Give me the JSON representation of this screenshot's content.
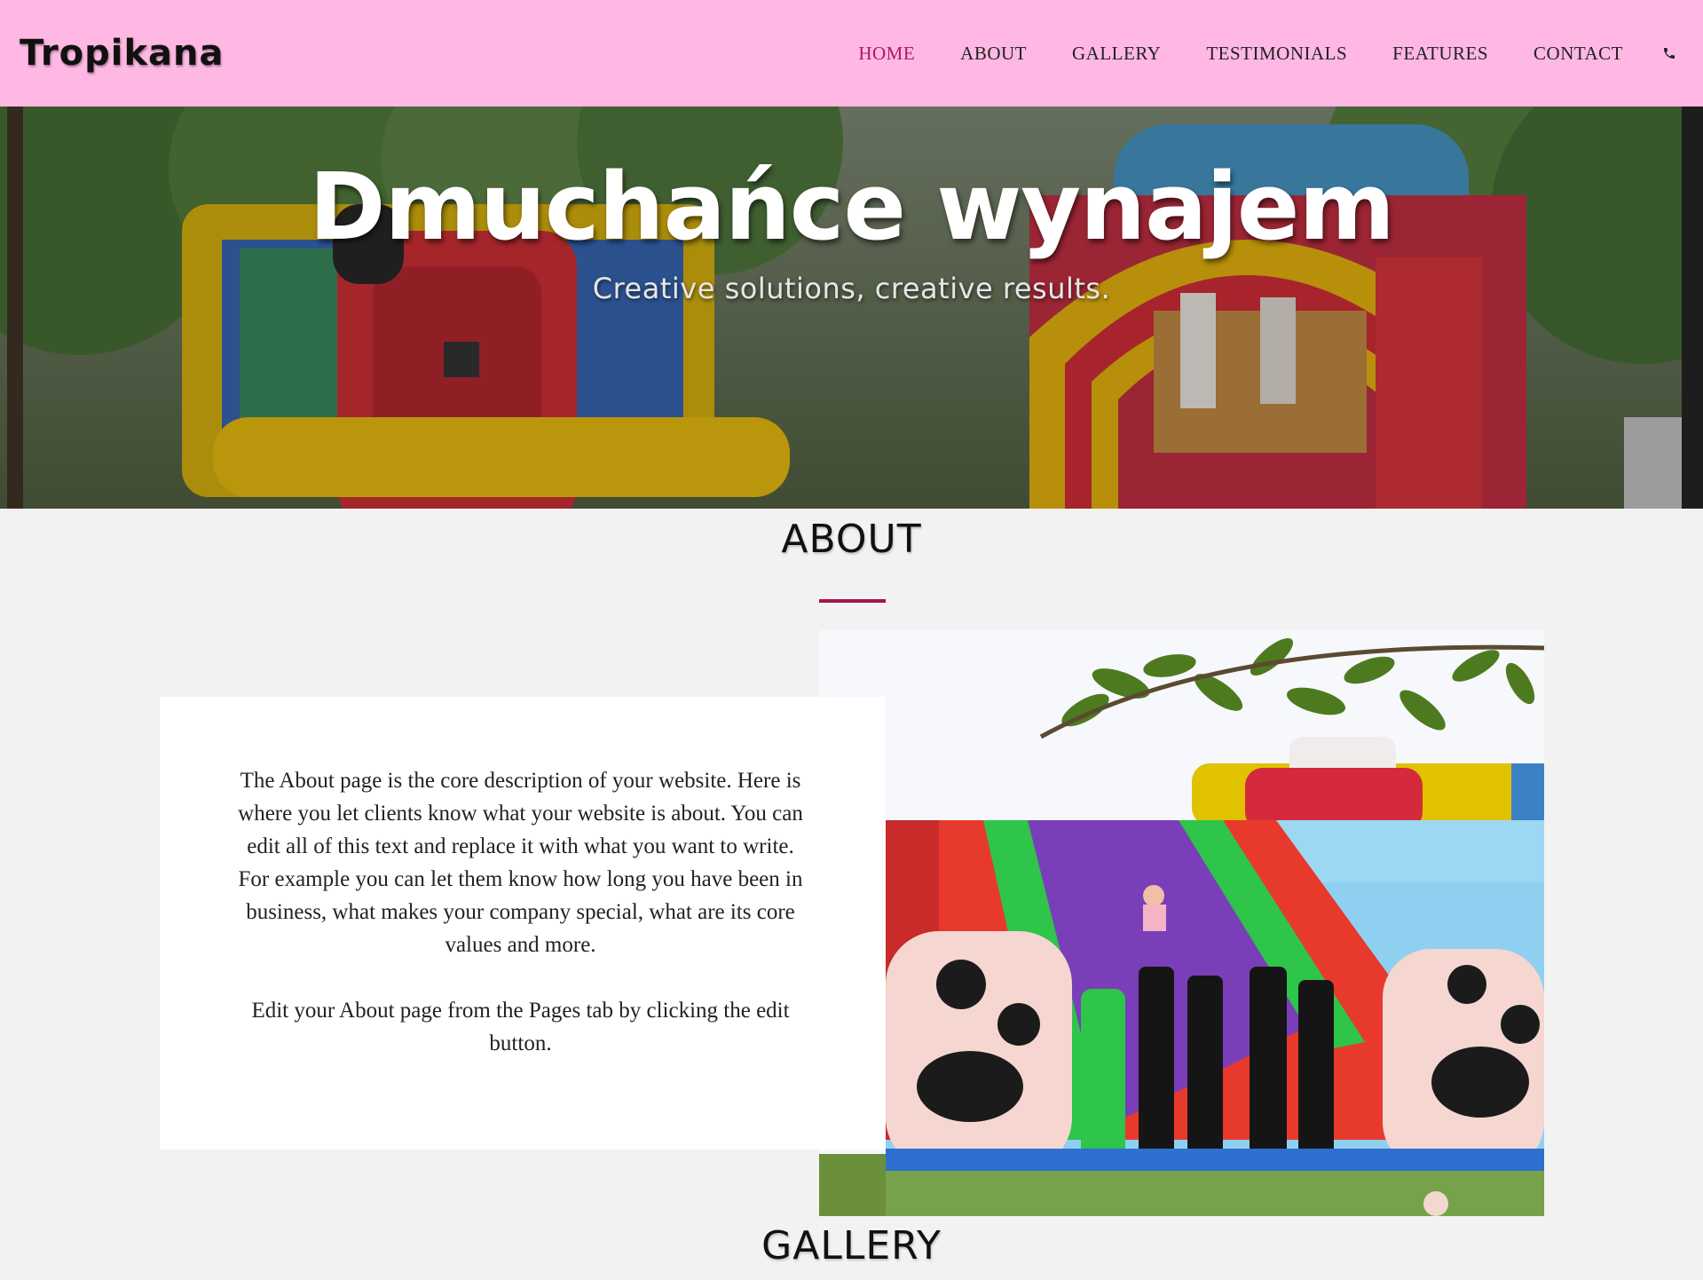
{
  "header": {
    "brand": "Tropikana",
    "nav": [
      {
        "label": "HOME",
        "active": true
      },
      {
        "label": "ABOUT"
      },
      {
        "label": "GALLERY"
      },
      {
        "label": "TESTIMONIALS"
      },
      {
        "label": "FEATURES"
      },
      {
        "label": "CONTACT"
      }
    ],
    "phone_icon": "phone-icon"
  },
  "hero": {
    "title": "Dmuchańce wynajem",
    "subtitle": "Creative solutions, creative results."
  },
  "about": {
    "title": "ABOUT",
    "paragraphs": [
      "The About page is the core description of your website. Here is where you let clients know what your website is about. You can edit all of this text and replace it with what you want to write. For example you can let them know how long you have been in business, what makes your company special, what are its core values and more.",
      "Edit your About page from the Pages tab by clicking the edit button."
    ]
  },
  "gallery": {
    "title": "GALLERY"
  },
  "colors": {
    "header_bg": "#ffb8e3",
    "accent": "#b0156a",
    "rule": "#a8124f",
    "page_bg": "#f2f2f2"
  }
}
